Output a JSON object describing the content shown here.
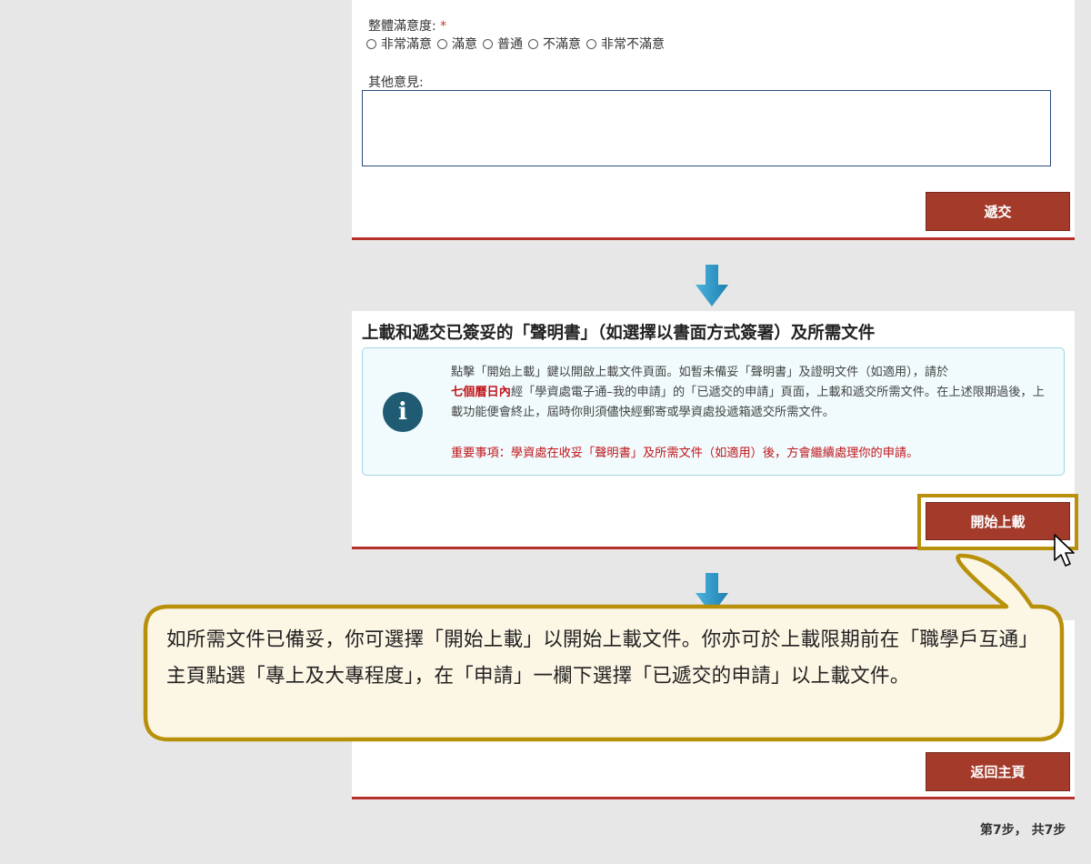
{
  "survey": {
    "satisfaction_label": "整體滿意度:",
    "required_mark": "*",
    "options": [
      "非常滿意",
      "滿意",
      "普通",
      "不滿意",
      "非常不滿意"
    ],
    "comments_label": "其他意見:",
    "submit_label": "遞交"
  },
  "upload_section": {
    "title": "上載和遞交已簽妥的「聲明書」（如選擇以書面方式簽署）及所需文件",
    "info_part1": "點擊「開始上載」鍵以開啟上載文件頁面。如暫未備妥「聲明書」及證明文件（如適用），請於",
    "info_highlight": "七個曆日內",
    "info_part2": "經「學資處電子通–我的申請」的「已遞交的申請」頁面，上載和遞交所需文件。在上述限期過後，上載功能便會終止，屆時你則須儘快經郵寄或學資處投遞箱遞交所需文件。",
    "important": "重要事項：學資處在收妥「聲明書」及所需文件（如適用）後，方會繼續處理你的申請。",
    "upload_label": "開始上載"
  },
  "callout": {
    "text": "如所需文件已備妥，你可選擇「開始上載」以開始上載文件。你亦可於上載限期前在「職學戶互通」主頁點選「專上及大專程度」，在「申請」一欄下選擇「已遞交的申請」以上載文件。"
  },
  "final": {
    "home_label": "返回主頁"
  },
  "step": "第7步， 共7步",
  "colors": {
    "button": "#a33a2a",
    "accent_line": "#b5302a",
    "highlight": "#b8900a",
    "arrow": "#2a8fc0"
  }
}
